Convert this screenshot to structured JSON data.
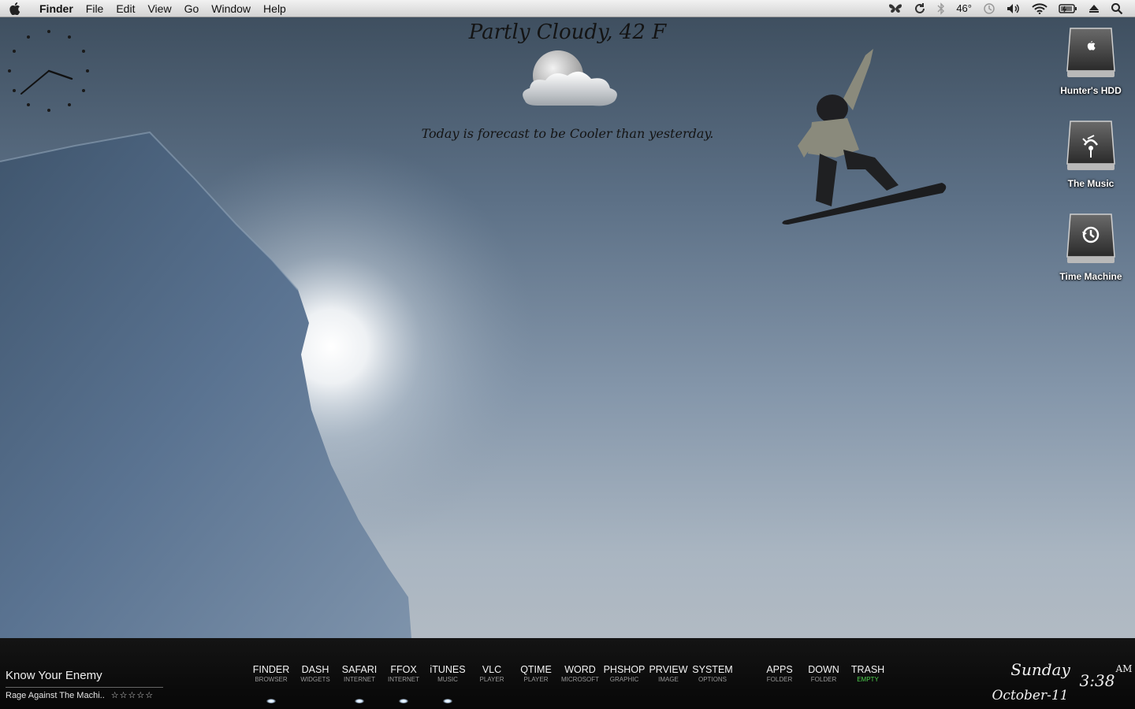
{
  "menubar": {
    "app_name": "Finder",
    "menus": [
      "File",
      "Edit",
      "View",
      "Go",
      "Window",
      "Help"
    ],
    "temperature": "46°"
  },
  "weather": {
    "condition": "Partly Cloudy, 42 F",
    "forecast": "Today is forecast to be Cooler than yesterday.",
    "icon": "partly-cloudy-moon-icon"
  },
  "desktop": {
    "drives": [
      {
        "label": "Hunter's HDD",
        "icon": "apple-hdd-icon"
      },
      {
        "label": "The Music",
        "icon": "firewire-drive-icon"
      },
      {
        "label": "Time Machine",
        "icon": "time-machine-drive-icon"
      }
    ]
  },
  "now_playing": {
    "track": "Know Your Enemy",
    "artist": "Rage Against The Machi..",
    "rating": "☆☆☆☆☆"
  },
  "dock": {
    "items": [
      {
        "name": "FINDER",
        "sub": "BROWSER",
        "running": true
      },
      {
        "name": "DASH",
        "sub": "WIDGETS",
        "running": false
      },
      {
        "name": "SAFARI",
        "sub": "INTERNET",
        "running": true
      },
      {
        "name": "FFOX",
        "sub": "INTERNET",
        "running": true
      },
      {
        "name": "iTUNES",
        "sub": "MUSIC",
        "running": true
      },
      {
        "name": "VLC",
        "sub": "PLAYER",
        "running": false
      },
      {
        "name": "QTIME",
        "sub": "PLAYER",
        "running": false
      },
      {
        "name": "WORD",
        "sub": "MICROSOFT",
        "running": false
      },
      {
        "name": "PHSHOP",
        "sub": "GRAPHIC",
        "running": false
      },
      {
        "name": "PRVIEW",
        "sub": "IMAGE",
        "running": false
      },
      {
        "name": "SYSTEM",
        "sub": "OPTIONS",
        "running": false
      },
      {
        "name": "APPS",
        "sub": "FOLDER",
        "running": false
      },
      {
        "name": "DOWN",
        "sub": "FOLDER",
        "running": false
      },
      {
        "name": "TRASH",
        "sub": "EMPTY",
        "running": false
      }
    ],
    "trash_status_color": "#4ed14e"
  },
  "datetime": {
    "day": "Sunday",
    "date": "October-11",
    "time": "3:38",
    "ampm": "AM"
  }
}
